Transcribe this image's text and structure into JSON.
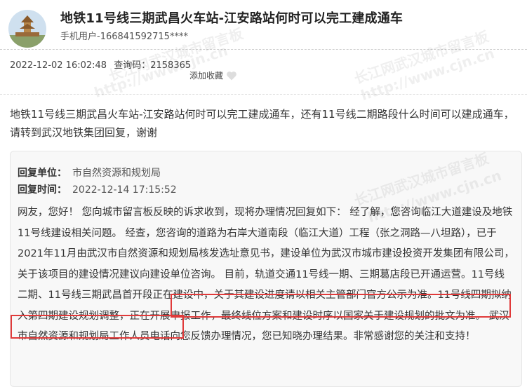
{
  "post": {
    "title": "地铁11号线三期武昌火车站-江安路站何时可以完工建成通车",
    "user": "手机用户-16684159271​5****",
    "date": "2022-12-02 16:02:48",
    "query_label": "查询码：",
    "query_code": "2158365",
    "favorite_label": "添加收藏",
    "question": "地铁11号线三期武昌火车站-江安路站何时可以完工建成通车，还有11号线二期路段什么时间可以建成通车，请转到武汉地铁集团回复，谢谢"
  },
  "reply": {
    "unit_label": "回复单位：",
    "unit": "市自然资源和规划局",
    "time_label": "回复时间：",
    "time": "2022-12-14 17:15:52",
    "text_before": "网友，您好！ 您向城市留言板反映的诉求收到，现将办理情况回复如下： 经了解，您咨询临江大道建设及地铁11号线建设相关问题。 经查，您咨询的道路为右岸大道南段（临江大道）工程（张之洞路—八坦路），已于2021年11月由武汉市自然资源和规划局核发选址意见书，建设单位为武汉市城市建设投资开发集团有限公司，关于该项目的建设情况建议向建设单位咨询。 目前，轨道交通11号线一期、三期葛店段已开通运营。",
    "text_highlight": "11号线二期、11号线三期武昌首开段正在建设中，关于其建设进度请以相关主管部门官方公示为准。",
    "text_after": "11号线四期拟纳入第四期建设规划调整，正在开展申报工作，最终线位方案和建设时序以国家关于建设规划的批文为准。 武汉市自然资源和规划局工作人员电话向您反馈办理情况，您已知晓办理结果。非常感谢您的关注和支持！"
  },
  "watermarks": [
    "长江网武汉城市留言板",
    "http://www.cjn.cn",
    "长江网武汉城市留言板",
    "http://www.cjn.cn",
    "长江网武汉城市留言板",
    "http://www.cjn.cn"
  ],
  "colors": {
    "highlight": "#e03a3a",
    "reply_bg": "#f8f8f8"
  }
}
